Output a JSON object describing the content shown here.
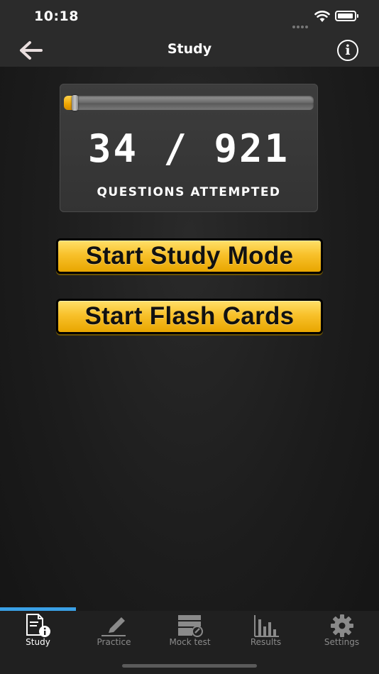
{
  "status_bar": {
    "time": "10:18"
  },
  "nav": {
    "title": "Study"
  },
  "progress": {
    "attempted": 34,
    "total": 921,
    "count_text": "34 / 921",
    "label": "QUESTIONS ATTEMPTED"
  },
  "buttons": {
    "study_mode": "Start Study Mode",
    "flash_cards": "Start Flash Cards"
  },
  "tabs": [
    {
      "label": "Study",
      "icon": "study-document-icon",
      "active": true
    },
    {
      "label": "Practice",
      "icon": "pencil-icon",
      "active": false
    },
    {
      "label": "Mock test",
      "icon": "mock-test-icon",
      "active": false
    },
    {
      "label": "Results",
      "icon": "bar-chart-icon",
      "active": false
    },
    {
      "label": "Settings",
      "icon": "gear-icon",
      "active": false
    }
  ],
  "colors": {
    "accent_gold": "#f8c12b",
    "tab_indicator": "#3aa0e6",
    "background": "#1c1c1c"
  }
}
